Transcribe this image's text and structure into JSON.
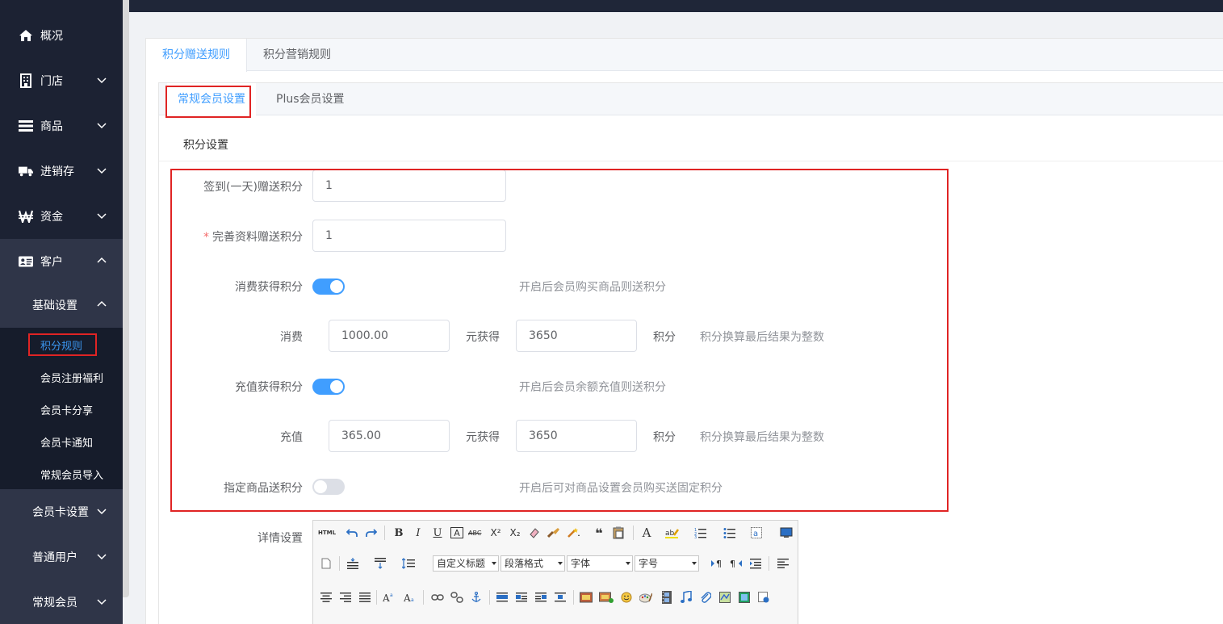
{
  "sidebar": {
    "items": [
      {
        "label": "概况",
        "icon": "home-icon"
      },
      {
        "label": "门店",
        "icon": "building-icon"
      },
      {
        "label": "商品",
        "icon": "list-icon"
      },
      {
        "label": "进销存",
        "icon": "truck-icon"
      },
      {
        "label": "资金",
        "icon": "won-icon"
      },
      {
        "label": "客户",
        "icon": "id-card-icon"
      }
    ],
    "base_settings": "基础设置",
    "sub_items": [
      "积分规则",
      "会员注册福利",
      "会员卡分享",
      "会员卡通知",
      "常规会员导入"
    ],
    "lower_items": [
      "会员卡设置",
      "普通用户",
      "常规会员"
    ]
  },
  "tabs": [
    "积分赠送规则",
    "积分营销规则"
  ],
  "inner_tabs": [
    "常规会员设置",
    "Plus会员设置"
  ],
  "section_title": "积分设置",
  "form": {
    "checkin_label": "签到(一天)赠送积分",
    "checkin_value": "1",
    "profile_required": "*",
    "profile_label": "完善资料赠送积分",
    "profile_value": "1",
    "consume_label": "消费获得积分",
    "consume_on": true,
    "consume_hint": "开启后会员购买商品则送积分",
    "consume_row_label": "消费",
    "consume_amount": "1000.00",
    "yuan_get": "元获得",
    "consume_points": "3650",
    "points_unit": "积分",
    "int_hint": "积分换算最后结果为整数",
    "recharge_label": "充值获得积分",
    "recharge_on": true,
    "recharge_hint": "开启后会员余额充值则送积分",
    "recharge_row_label": "充值",
    "recharge_amount": "365.00",
    "recharge_points": "3650",
    "goods_label": "指定商品送积分",
    "goods_on": false,
    "goods_hint": "开启后可对商品设置会员购买送固定积分",
    "detail_label": "详情设置"
  },
  "editor": {
    "html_btn": "HTML",
    "bold": "B",
    "italic": "I",
    "underline": "U",
    "font_color": "A",
    "strike": "ABC",
    "sup": "X²",
    "sub": "X₂",
    "quote": "❝",
    "custom_title": "自定义标题",
    "paragraph": "段落格式",
    "font_family": "字体",
    "font_size": "字号"
  },
  "colors": {
    "sidebar_bg": "#1c2233",
    "accent": "#409eff",
    "highlight_red": "#e02424"
  }
}
